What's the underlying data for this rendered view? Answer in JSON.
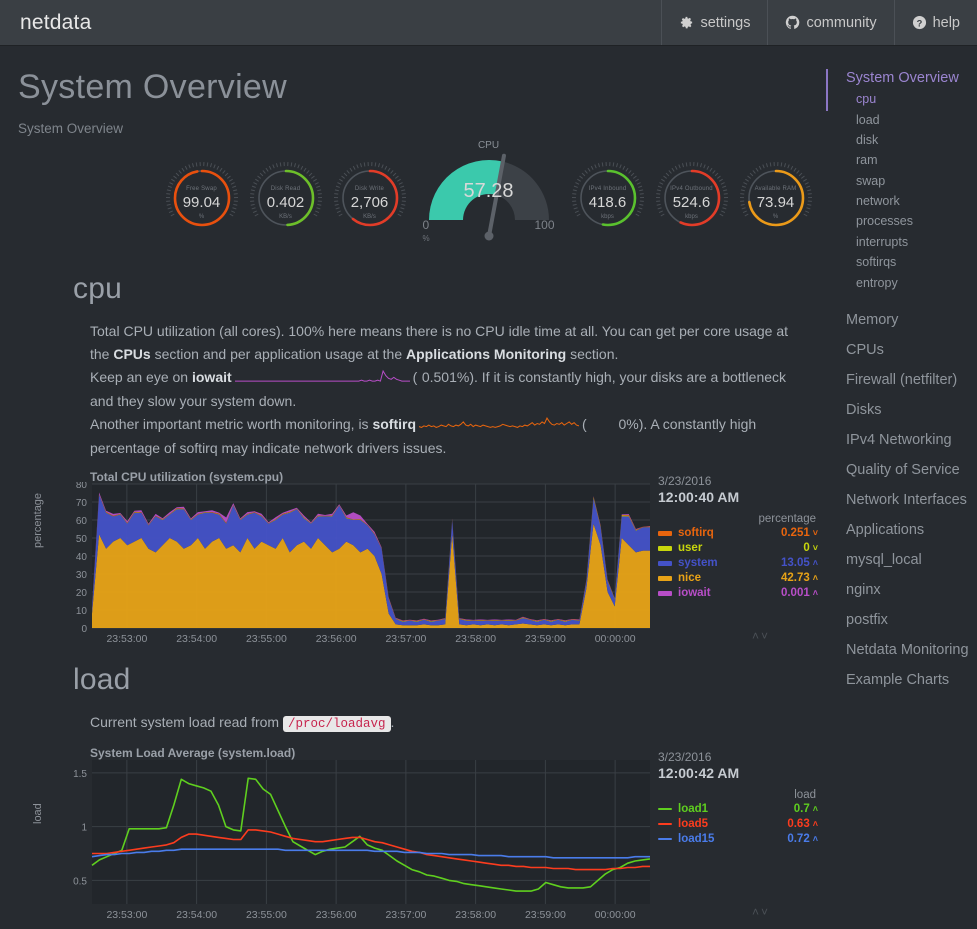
{
  "navbar": {
    "brand": "netdata",
    "items": [
      {
        "label": "settings",
        "icon": "gear-icon"
      },
      {
        "label": "community",
        "icon": "github-icon"
      },
      {
        "label": "help",
        "icon": "question-circle-icon"
      }
    ]
  },
  "page": {
    "title": "System Overview",
    "subtitle": "System Overview"
  },
  "gauges": {
    "cpu": {
      "title": "CPU",
      "value": "57.28",
      "min": "0",
      "max": "100",
      "unit": "%",
      "percent": 57.28,
      "color": "#3BC9AC"
    },
    "items": [
      {
        "label": "Free Swap",
        "value": "99.04",
        "unit": "%",
        "percent": 99.04,
        "color": "#E8500E"
      },
      {
        "label": "Disk Read",
        "value": "0.402",
        "unit": "KB/s",
        "percent": 50.0,
        "color": "#6DBF2A"
      },
      {
        "label": "Disk Write",
        "value": "2,706",
        "unit": "KB/s",
        "percent": 62.0,
        "color": "#E23C28"
      },
      {
        "label": "IPv4 Inbound",
        "value": "418.6",
        "unit": "kbps",
        "percent": 54.0,
        "color": "#5AC12E"
      },
      {
        "label": "IPv4 Outbound",
        "value": "524.6",
        "unit": "kbps",
        "percent": 58.0,
        "color": "#E23C28"
      },
      {
        "label": "Available RAM",
        "value": "73.94",
        "unit": "%",
        "percent": 73.94,
        "color": "#EB9A19"
      }
    ]
  },
  "cpu_section": {
    "heading": "cpu",
    "text_1a": "Total CPU utilization (all cores). 100% here means there is no CPU idle time at all. You can get per core usage at the ",
    "link_cpus": "CPUs",
    "text_1b": " section and per application usage at the ",
    "link_apps": "Applications Monitoring",
    "text_1c": " section.",
    "text_2a": "Keep an eye on ",
    "bold_iowait": "iowait",
    "iowait_value": "0.501%",
    "text_2b": "). If it is constantly high, your disks are a bottleneck and they slow your system down.",
    "text_3a": "Another important metric worth monitoring, is ",
    "bold_softirq": "softirq",
    "softirq_value": "0%",
    "text_3b": "). A constantly high percentage of softirq may indicate network drivers issues."
  },
  "load_section": {
    "heading": "load",
    "text_a": "Current system load read from ",
    "code": "/proc/loadavg",
    "text_b": "."
  },
  "sidebar": {
    "group_title": "System Overview",
    "subitems": [
      {
        "label": "cpu",
        "active": true
      },
      {
        "label": "load",
        "active": false
      },
      {
        "label": "disk",
        "active": false
      },
      {
        "label": "ram",
        "active": false
      },
      {
        "label": "swap",
        "active": false
      },
      {
        "label": "network",
        "active": false
      },
      {
        "label": "processes",
        "active": false
      },
      {
        "label": "interrupts",
        "active": false
      },
      {
        "label": "softirqs",
        "active": false
      },
      {
        "label": "entropy",
        "active": false
      }
    ],
    "items": [
      {
        "label": "Memory"
      },
      {
        "label": "CPUs"
      },
      {
        "label": "Firewall (netfilter)"
      },
      {
        "label": "Disks"
      },
      {
        "label": "IPv4 Networking"
      },
      {
        "label": "Quality of Service"
      },
      {
        "label": "Network Interfaces"
      },
      {
        "label": "Applications"
      },
      {
        "label": "mysql_local"
      },
      {
        "label": "nginx"
      },
      {
        "label": "postfix"
      },
      {
        "label": "Netdata Monitoring"
      },
      {
        "label": "Example Charts"
      }
    ]
  },
  "chart_data": [
    {
      "type": "area",
      "id": "system.cpu",
      "title": "Total CPU utilization (system.cpu)",
      "ylabel": "percentage",
      "ylim": [
        0,
        80
      ],
      "yticks": [
        0,
        10,
        20,
        30,
        40,
        50,
        60,
        70,
        80
      ],
      "xticks": [
        "23:53:00",
        "23:54:00",
        "23:55:00",
        "23:56:00",
        "23:57:00",
        "23:58:00",
        "23:59:00",
        "00:00:00"
      ],
      "grid": true,
      "stacked": true,
      "legend_position": "right",
      "legend_date": "3/23/2016",
      "legend_time": "12:00:40 AM",
      "legend_unit": "percentage",
      "series": [
        {
          "name": "softirq",
          "color": "#E8650E",
          "value": "0.251",
          "arrow": "˅",
          "values": [
            0.3,
            0.2,
            0.4,
            0.3,
            0.2,
            0.3,
            0.4,
            0.3,
            0.2,
            0.3,
            0.3,
            0.2,
            0.4,
            0.3,
            0.2,
            0.3,
            0.2,
            0.3,
            0.4,
            0.3,
            0.2,
            0.3,
            0.2,
            0.3,
            0.3,
            0.2,
            0.3,
            0.4,
            0.3,
            0.2,
            0.3,
            0.2,
            0.3,
            0.2,
            0.3,
            0.2,
            0.3,
            0.2,
            0.3,
            0.2,
            0.3,
            0.2,
            0.3,
            0.2,
            0.3,
            0.2,
            0.3,
            0.2,
            0.3,
            0.2,
            0.2,
            0.3,
            0.2,
            0.3,
            0.2,
            0.3,
            0.2,
            0.3,
            0.2,
            0.3,
            0.2,
            0.3,
            0.2,
            0.3,
            0.2,
            0.3,
            0.2,
            0.3,
            0.2,
            0.3,
            0.3,
            0.4,
            0.3,
            0.3,
            0.2,
            0.3,
            0.4,
            0.3,
            0.25,
            0.3
          ]
        },
        {
          "name": "user",
          "color": "#C8D60C",
          "value": "0",
          "arrow": "˅",
          "values": [
            0.2,
            0.1,
            0.2,
            0.1,
            0.2,
            0.1,
            0.2,
            0.1,
            0.2,
            0.1,
            0.2,
            0.1,
            0.2,
            0.1,
            0.2,
            0.1,
            0.2,
            0.1,
            0.2,
            0.1,
            0.2,
            0.1,
            0.2,
            0.1,
            0.2,
            0.1,
            0.2,
            0.1,
            0.2,
            0.1,
            0.2,
            0.1,
            0.2,
            0.1,
            0.2,
            0.1,
            0.2,
            0.1,
            0.2,
            0.1,
            0.2,
            0.1,
            0.2,
            0.1,
            0.2,
            0.1,
            0.2,
            0.1,
            0.2,
            0.1,
            0.1,
            0.2,
            0.1,
            0.2,
            0.1,
            0.2,
            0.1,
            0.2,
            0.1,
            0.2,
            0.1,
            0.2,
            0.1,
            0.2,
            0.1,
            0.2,
            0.1,
            0.2,
            0.1,
            0.2,
            0.3,
            0.6,
            0.4,
            0.3,
            0.2,
            0.5,
            0.4,
            0.3,
            0,
            0.1
          ]
        },
        {
          "name": "system",
          "color": "#4452C8",
          "value": "13.05",
          "arrow": "˄",
          "values": [
            3,
            22,
            20,
            14,
            13,
            12,
            16,
            14,
            13,
            20,
            14,
            13,
            18,
            22,
            14,
            13,
            20,
            16,
            13,
            14,
            22,
            18,
            13,
            20,
            14,
            12,
            16,
            13,
            22,
            20,
            13,
            14,
            12,
            16,
            20,
            24,
            13,
            14,
            18,
            13,
            12,
            14,
            8,
            3,
            2,
            2.5,
            2,
            2.5,
            2,
            2.5,
            3,
            8,
            3,
            2.5,
            2,
            2.5,
            2,
            2.5,
            2,
            2.5,
            2,
            3,
            2.5,
            2,
            2.5,
            2,
            2.5,
            2,
            2.5,
            2,
            4,
            14,
            10,
            6,
            4,
            12,
            16,
            12,
            13,
            13
          ]
        },
        {
          "name": "nice",
          "color": "#E8A317",
          "value": "42.73",
          "arrow": "˄",
          "values": [
            8,
            52,
            44,
            48,
            50,
            46,
            48,
            50,
            44,
            42,
            46,
            50,
            48,
            44,
            46,
            50,
            44,
            48,
            50,
            44,
            46,
            42,
            50,
            44,
            48,
            46,
            44,
            50,
            42,
            46,
            48,
            44,
            50,
            46,
            42,
            44,
            48,
            46,
            42,
            44,
            40,
            30,
            8,
            2,
            1.5,
            1.5,
            1.5,
            2,
            1.5,
            1.5,
            2,
            52,
            2,
            1.5,
            2,
            1.5,
            2,
            1.5,
            2,
            1.5,
            2,
            2.5,
            2,
            1.5,
            2,
            1.5,
            2,
            1.5,
            2,
            2,
            22,
            58,
            46,
            20,
            12,
            50,
            46,
            42,
            43,
            43
          ]
        },
        {
          "name": "iowait",
          "color": "#B84EC8",
          "value": "0.001",
          "arrow": "˄",
          "values": [
            0.5,
            1,
            0.5,
            1,
            0.5,
            1,
            0.5,
            1,
            0.5,
            1,
            0.5,
            1,
            0.5,
            1,
            0.5,
            1,
            0.5,
            1,
            0.5,
            3,
            1,
            0.5,
            1,
            0.5,
            1,
            0.5,
            1,
            0.5,
            1,
            0.5,
            1,
            0.5,
            1,
            0.5,
            1,
            0.5,
            1,
            4,
            2,
            0.5,
            1,
            0.5,
            0.5,
            0.3,
            0.2,
            0.3,
            0.2,
            0.3,
            0.2,
            0.3,
            0.2,
            0.3,
            0.2,
            0.3,
            0.2,
            0.3,
            0.2,
            0.3,
            0.2,
            0.3,
            0.2,
            0.3,
            0.2,
            0.3,
            0.2,
            0.3,
            0.2,
            0.3,
            0.2,
            0.3,
            0.2,
            0.3,
            0.4,
            0.3,
            0.2,
            0.3,
            0.5,
            0.4,
            0.001,
            0.2
          ]
        }
      ]
    },
    {
      "type": "line",
      "id": "system.load",
      "title": "System Load Average (system.load)",
      "ylabel": "load",
      "ylim": [
        0.28,
        1.62
      ],
      "yticks": [
        0.5,
        1,
        1.5
      ],
      "xticks": [
        "23:53:00",
        "23:54:00",
        "23:55:00",
        "23:56:00",
        "23:57:00",
        "23:58:00",
        "23:59:00",
        "00:00:00"
      ],
      "grid": true,
      "legend_position": "right",
      "legend_date": "3/23/2016",
      "legend_time": "12:00:42 AM",
      "legend_unit": "load",
      "series": [
        {
          "name": "load1",
          "color": "#5FCF1F",
          "value": "0.7",
          "arrow": "˄",
          "values": [
            0.64,
            0.69,
            0.72,
            0.75,
            0.78,
            0.98,
            0.98,
            0.98,
            0.98,
            0.98,
            0.99,
            1.2,
            1.44,
            1.4,
            1.38,
            1.36,
            1.33,
            1.2,
            1.0,
            0.97,
            0.96,
            1.45,
            1.44,
            1.35,
            1.3,
            1.15,
            1.0,
            0.86,
            0.82,
            0.78,
            0.74,
            0.77,
            0.79,
            0.8,
            0.81,
            0.86,
            0.91,
            0.83,
            0.8,
            0.78,
            0.73,
            0.68,
            0.64,
            0.6,
            0.58,
            0.55,
            0.54,
            0.52,
            0.5,
            0.49,
            0.47,
            0.46,
            0.45,
            0.44,
            0.43,
            0.42,
            0.41,
            0.4,
            0.4,
            0.4,
            0.42,
            0.48,
            0.46,
            0.44,
            0.43,
            0.43,
            0.43,
            0.44,
            0.5,
            0.56,
            0.6,
            0.62,
            0.66,
            0.68,
            0.69,
            0.7
          ]
        },
        {
          "name": "load5",
          "color": "#FD3C1E",
          "value": "0.63",
          "arrow": "˄",
          "values": [
            0.75,
            0.75,
            0.75,
            0.76,
            0.77,
            0.78,
            0.79,
            0.8,
            0.81,
            0.82,
            0.83,
            0.85,
            0.9,
            0.93,
            0.93,
            0.92,
            0.91,
            0.9,
            0.89,
            0.88,
            0.88,
            0.97,
            0.97,
            0.96,
            0.95,
            0.93,
            0.91,
            0.89,
            0.88,
            0.87,
            0.86,
            0.86,
            0.87,
            0.88,
            0.89,
            0.9,
            0.9,
            0.88,
            0.86,
            0.85,
            0.83,
            0.81,
            0.79,
            0.77,
            0.76,
            0.74,
            0.73,
            0.72,
            0.71,
            0.7,
            0.69,
            0.68,
            0.67,
            0.66,
            0.65,
            0.64,
            0.64,
            0.63,
            0.63,
            0.62,
            0.62,
            0.62,
            0.61,
            0.61,
            0.61,
            0.6,
            0.6,
            0.6,
            0.6,
            0.6,
            0.61,
            0.61,
            0.62,
            0.62,
            0.63,
            0.63
          ]
        },
        {
          "name": "load15",
          "color": "#4A7CEA",
          "value": "0.72",
          "arrow": "˄",
          "values": [
            0.72,
            0.73,
            0.74,
            0.74,
            0.75,
            0.75,
            0.76,
            0.76,
            0.77,
            0.77,
            0.78,
            0.78,
            0.79,
            0.79,
            0.79,
            0.79,
            0.79,
            0.79,
            0.79,
            0.79,
            0.79,
            0.79,
            0.79,
            0.79,
            0.79,
            0.79,
            0.78,
            0.78,
            0.78,
            0.78,
            0.78,
            0.78,
            0.78,
            0.78,
            0.78,
            0.78,
            0.78,
            0.78,
            0.77,
            0.77,
            0.77,
            0.77,
            0.76,
            0.76,
            0.76,
            0.75,
            0.75,
            0.75,
            0.74,
            0.74,
            0.74,
            0.74,
            0.73,
            0.73,
            0.73,
            0.73,
            0.72,
            0.72,
            0.72,
            0.72,
            0.72,
            0.72,
            0.71,
            0.71,
            0.71,
            0.71,
            0.71,
            0.71,
            0.71,
            0.71,
            0.71,
            0.71,
            0.71,
            0.72,
            0.72,
            0.72
          ]
        }
      ]
    }
  ],
  "sparklines": {
    "iowait": {
      "color": "#B84EC8",
      "values": [
        1,
        1,
        1,
        1,
        1,
        1,
        1,
        1,
        1,
        1,
        1,
        1,
        1,
        1,
        1,
        1,
        1,
        1,
        1,
        1,
        1,
        1,
        1,
        1,
        1,
        1,
        1,
        1,
        1,
        1,
        1,
        1,
        1,
        1,
        1,
        1,
        1,
        1,
        1,
        1,
        1,
        1,
        1,
        1,
        1,
        1,
        1,
        2,
        1,
        1,
        2,
        1,
        1,
        2,
        1,
        12,
        7,
        4,
        3,
        5,
        3,
        2,
        1,
        1,
        1,
        1
      ]
    },
    "softirq": {
      "color": "#E8650E",
      "values": [
        3,
        2,
        4,
        3,
        5,
        3,
        4,
        2,
        3,
        5,
        4,
        3,
        6,
        4,
        3,
        5,
        4,
        6,
        9,
        5,
        4,
        6,
        3,
        5,
        4,
        3,
        5,
        4,
        3,
        2,
        3,
        2,
        3,
        4,
        6,
        5,
        4,
        3,
        4,
        3,
        2,
        4,
        3,
        5,
        4,
        6,
        8,
        5,
        7,
        6,
        9,
        7,
        14,
        9,
        6,
        5,
        7,
        6,
        8,
        5,
        7,
        9,
        6,
        8,
        5,
        4
      ]
    }
  },
  "chart_scroll_icon": "˄˅"
}
